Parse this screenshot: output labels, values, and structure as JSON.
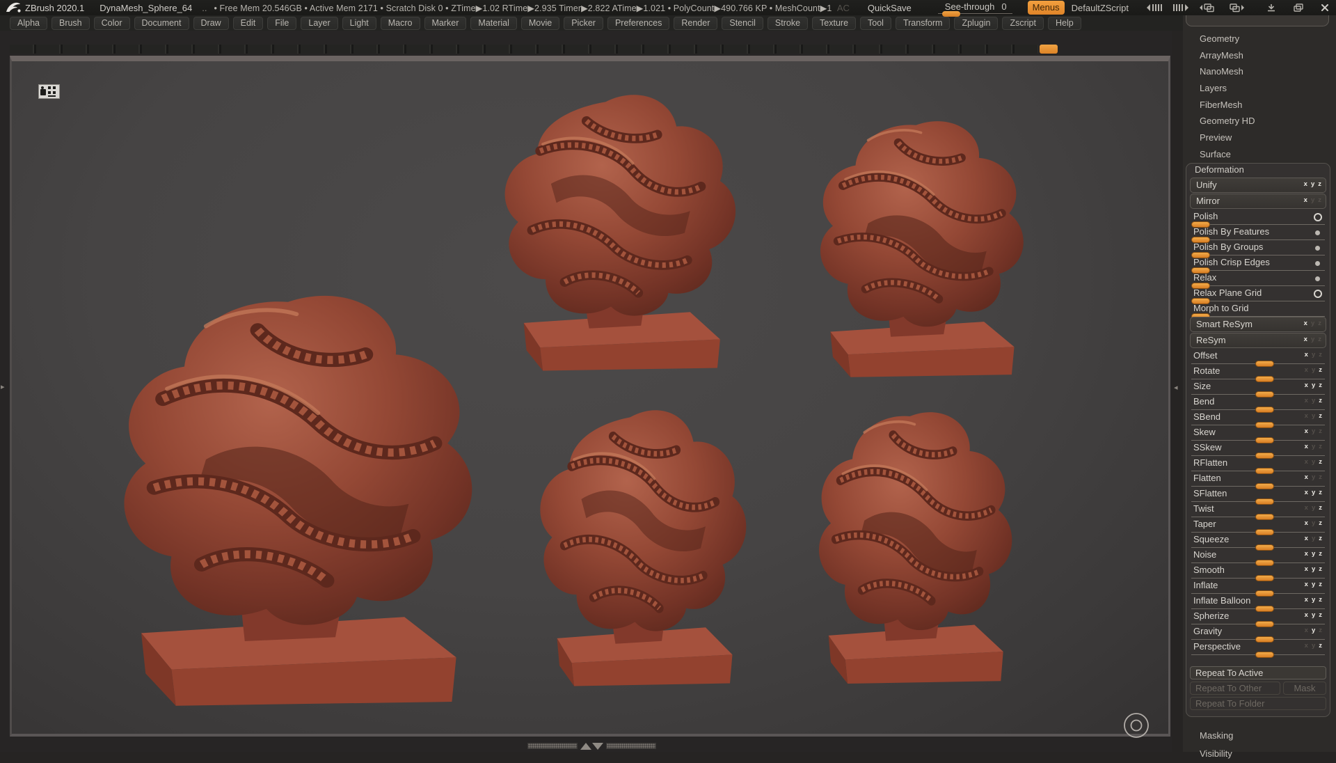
{
  "titlebar": {
    "app_name": "ZBrush 2020.1",
    "document_name": "DynaMesh_Sphere_64",
    "ellipsis": "..",
    "stats": "• Free Mem 20.546GB  • Active Mem 2171  • Scratch Disk 0 •  ZTime▶1.02 RTime▶2.935 Timer▶2.822 ATime▶1.021  • PolyCount▶490.766 KP   • MeshCount▶1",
    "ac_label": "AC",
    "quicksave_label": "QuickSave",
    "see_through_label": "See-through",
    "see_through_value": "0",
    "menus_label": "Menus",
    "zscript_label": "DefaultZScript"
  },
  "menubar": {
    "items": [
      "Alpha",
      "Brush",
      "Color",
      "Document",
      "Draw",
      "Edit",
      "File",
      "Layer",
      "Light",
      "Macro",
      "Marker",
      "Material",
      "Movie",
      "Picker",
      "Preferences",
      "Render",
      "Stencil",
      "Stroke",
      "Texture",
      "Tool",
      "Transform",
      "Zplugin",
      "Zscript",
      "Help"
    ]
  },
  "panel": {
    "sections_top": [
      "Geometry",
      "ArrayMesh",
      "NanoMesh",
      "Layers",
      "FiberMesh",
      "Geometry HD",
      "Preview",
      "Surface"
    ],
    "deformation": {
      "title": "Deformation",
      "rows": [
        {
          "label": "Unify",
          "is_button": 1,
          "ax": {
            "x": 1,
            "y": 1,
            "z": 1
          }
        },
        {
          "label": "Mirror",
          "is_button": 1,
          "ax": {
            "x": 1
          }
        },
        {
          "label": "Polish",
          "pos": 0,
          "ring": 1,
          "no_axes": 1
        },
        {
          "label": "Polish By Features",
          "pos": 0,
          "dot": 1,
          "no_axes": 1
        },
        {
          "label": "Polish By Groups",
          "pos": 0,
          "dot": 1,
          "no_axes": 1
        },
        {
          "label": "Polish Crisp Edges",
          "pos": 0,
          "dot": 1,
          "no_axes": 1
        },
        {
          "label": "Relax",
          "pos": 0,
          "dot": 1,
          "no_axes": 1
        },
        {
          "label": "Relax Plane Grid",
          "pos": 0,
          "ring": 1,
          "no_axes": 1
        },
        {
          "label": "Morph to Grid",
          "pos": 0,
          "no_axes": 1
        },
        {
          "label": "Smart ReSym",
          "is_button": 1,
          "ax": {
            "x": 1
          }
        },
        {
          "label": "ReSym",
          "is_button": 1,
          "ax": {
            "x": 1
          }
        },
        {
          "label": "Offset",
          "pos": 48,
          "ax": {
            "x": 1
          }
        },
        {
          "label": "Rotate",
          "pos": 48,
          "ax": {
            "z": 1
          }
        },
        {
          "label": "Size",
          "pos": 48,
          "ax": {
            "x": 1,
            "y": 1,
            "z": 1
          }
        },
        {
          "label": "Bend",
          "pos": 48,
          "ax": {
            "z": 1
          }
        },
        {
          "label": "SBend",
          "pos": 48,
          "ax": {
            "z": 1
          }
        },
        {
          "label": "Skew",
          "pos": 48,
          "ax": {
            "x": 1
          }
        },
        {
          "label": "SSkew",
          "pos": 48,
          "ax": {
            "x": 1
          }
        },
        {
          "label": "RFlatten",
          "pos": 48,
          "ax": {
            "z": 1
          }
        },
        {
          "label": "Flatten",
          "pos": 48,
          "ax": {
            "x": 1
          }
        },
        {
          "label": "SFlatten",
          "pos": 48,
          "ax": {
            "x": 1,
            "y": 1,
            "z": 1
          }
        },
        {
          "label": "Twist",
          "pos": 48,
          "ax": {
            "z": 1
          }
        },
        {
          "label": "Taper",
          "pos": 48,
          "ax": {
            "x": 1,
            "z": 1
          }
        },
        {
          "label": "Squeeze",
          "pos": 48,
          "ax": {
            "x": 1,
            "z": 1
          }
        },
        {
          "label": "Noise",
          "pos": 48,
          "ax": {
            "x": 1,
            "y": 1,
            "z": 1
          }
        },
        {
          "label": "Smooth",
          "pos": 48,
          "ax": {
            "x": 1,
            "y": 1,
            "z": 1
          }
        },
        {
          "label": "Inflate",
          "pos": 48,
          "ax": {
            "x": 1,
            "y": 1,
            "z": 1
          }
        },
        {
          "label": "Inflate Balloon",
          "pos": 48,
          "ax": {
            "x": 1,
            "y": 1,
            "z": 1
          }
        },
        {
          "label": "Spherize",
          "pos": 48,
          "ax": {
            "x": 1,
            "y": 1,
            "z": 1
          }
        },
        {
          "label": "Gravity",
          "pos": 48,
          "ax": {
            "y": 1
          }
        },
        {
          "label": "Perspective",
          "pos": 48,
          "ax": {
            "z": 1
          }
        }
      ],
      "repeat_active": "Repeat To Active",
      "repeat_other": "Repeat To Other",
      "mask": "Mask",
      "repeat_folder": "Repeat To Folder"
    },
    "sections_bottom": [
      "Masking",
      "Visibility"
    ]
  },
  "colors": {
    "accent_orange": "#e8913a",
    "clay_mid": "#8e4433",
    "canvas_gray": "#454343"
  }
}
